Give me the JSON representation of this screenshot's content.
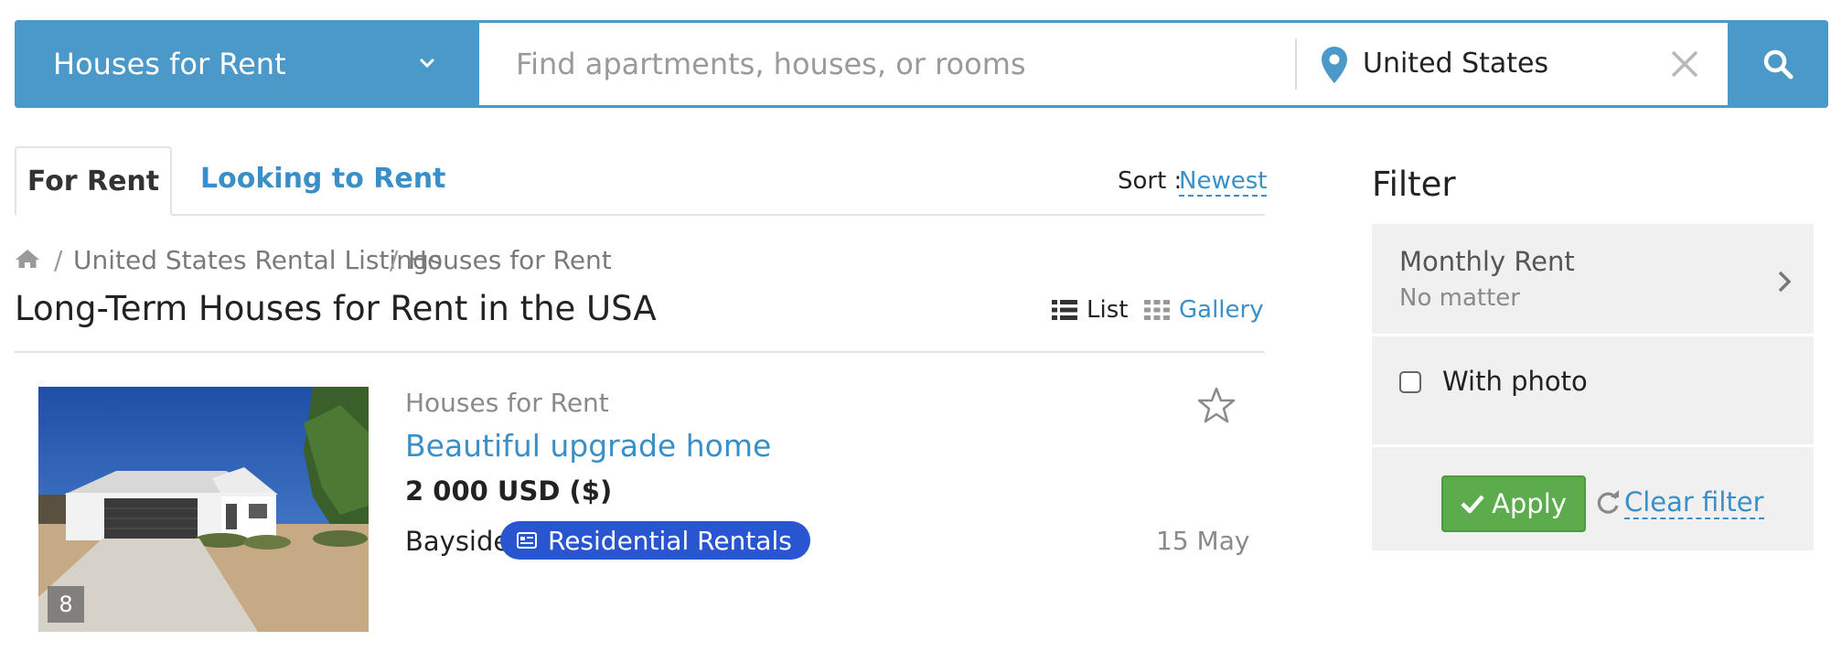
{
  "search": {
    "category": "Houses for Rent",
    "query_placeholder": "Find apartments, houses, or rooms",
    "query_value": "",
    "location": "United States"
  },
  "tabs": [
    {
      "label": "For Rent",
      "active": true
    },
    {
      "label": "Looking to Rent",
      "active": false
    }
  ],
  "sort": {
    "label": "Sort :",
    "value": "Newest"
  },
  "breadcrumb": {
    "separator": "/",
    "items": [
      "United States Rental Listings",
      "Houses for Rent"
    ]
  },
  "page_title": "Long-Term Houses for Rent in the USA",
  "view_toggle": {
    "list_label": "List",
    "gallery_label": "Gallery"
  },
  "listing": {
    "photo_count": "8",
    "category": "Houses for Rent",
    "title": "Beautiful upgrade home",
    "price": "2 000 USD ($)",
    "location": "Bayside",
    "tag": "Residential Rentals",
    "date": "15 May"
  },
  "filter": {
    "heading": "Filter",
    "monthly_rent_label": "Monthly Rent",
    "monthly_rent_value": "No matter",
    "with_photo_label": "With photo",
    "with_photo_checked": false,
    "apply_label": "Apply",
    "clear_label": "Clear filter"
  },
  "colors": {
    "primary_blue": "#4a99c9",
    "link_blue": "#3a8fc6",
    "tag_blue": "#2a55d0",
    "apply_green": "#5cab4c",
    "filter_bg": "#f0f0f0"
  },
  "icons": [
    "chevron-down-icon",
    "map-pin-icon",
    "close-icon",
    "search-icon",
    "home-icon",
    "list-icon",
    "grid-icon",
    "star-outline-icon",
    "listing-card-icon",
    "chevron-right-icon",
    "checkmark-icon",
    "refresh-icon"
  ]
}
